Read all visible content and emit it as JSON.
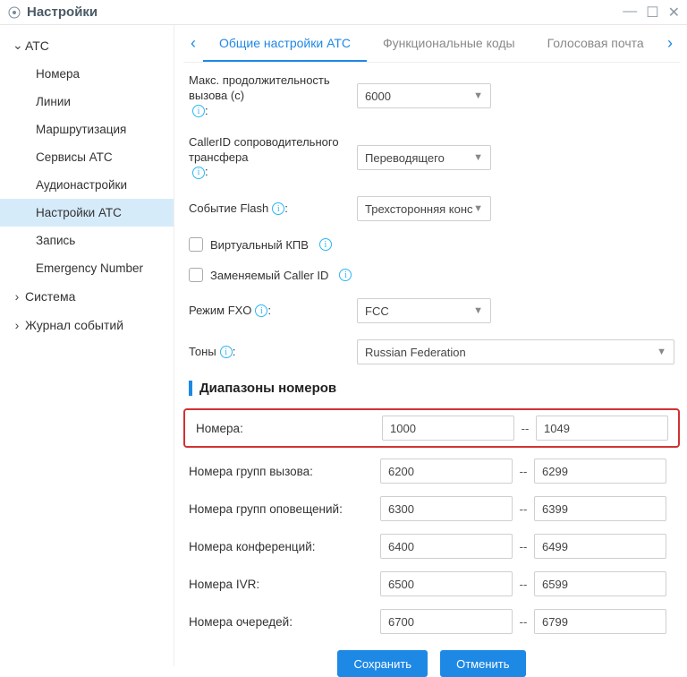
{
  "titlebar": {
    "title": "Настройки"
  },
  "sidebar": {
    "groups": [
      {
        "label": "АТС",
        "expanded": true,
        "items": [
          {
            "label": "Номера"
          },
          {
            "label": "Линии"
          },
          {
            "label": "Маршрутизация"
          },
          {
            "label": "Сервисы АТС"
          },
          {
            "label": "Аудионастройки"
          },
          {
            "label": "Настройки АТС",
            "active": true
          },
          {
            "label": "Запись"
          },
          {
            "label": "Emergency Number"
          }
        ]
      },
      {
        "label": "Система",
        "expanded": false
      },
      {
        "label": "Журнал событий",
        "expanded": false
      }
    ]
  },
  "tabs": {
    "items": [
      {
        "label": "Общие настройки АТС",
        "active": true
      },
      {
        "label": "Функциональные коды"
      },
      {
        "label": "Голосовая почта"
      }
    ]
  },
  "form": {
    "max_call_duration": {
      "label": "Макс. продолжительность вызова (с)",
      "value": "6000"
    },
    "callerid_transfer": {
      "label": "CallerID сопроводительного трансфера",
      "value": "Переводящего"
    },
    "flash_event": {
      "label": "Событие Flash",
      "value": "Трехсторонняя конс"
    },
    "virtual_kpv": {
      "label": "Виртуальный КПВ"
    },
    "replaceable_callerid": {
      "label": "Заменяемый Caller ID"
    },
    "fxo_mode": {
      "label": "Режим FXO",
      "value": "FCC"
    },
    "tones": {
      "label": "Тоны",
      "value": "Russian Federation"
    }
  },
  "ranges": {
    "heading": "Диапазоны номеров",
    "rows": [
      {
        "label": "Номера:",
        "from": "1000",
        "to": "1049",
        "highlight": true
      },
      {
        "label": "Номера групп вызова:",
        "from": "6200",
        "to": "6299"
      },
      {
        "label": "Номера групп оповещений:",
        "from": "6300",
        "to": "6399"
      },
      {
        "label": "Номера конференций:",
        "from": "6400",
        "to": "6499"
      },
      {
        "label": "Номера IVR:",
        "from": "6500",
        "to": "6599"
      },
      {
        "label": "Номера очередей:",
        "from": "6700",
        "to": "6799"
      }
    ]
  },
  "actions": {
    "save": "Сохранить",
    "cancel": "Отменить"
  }
}
